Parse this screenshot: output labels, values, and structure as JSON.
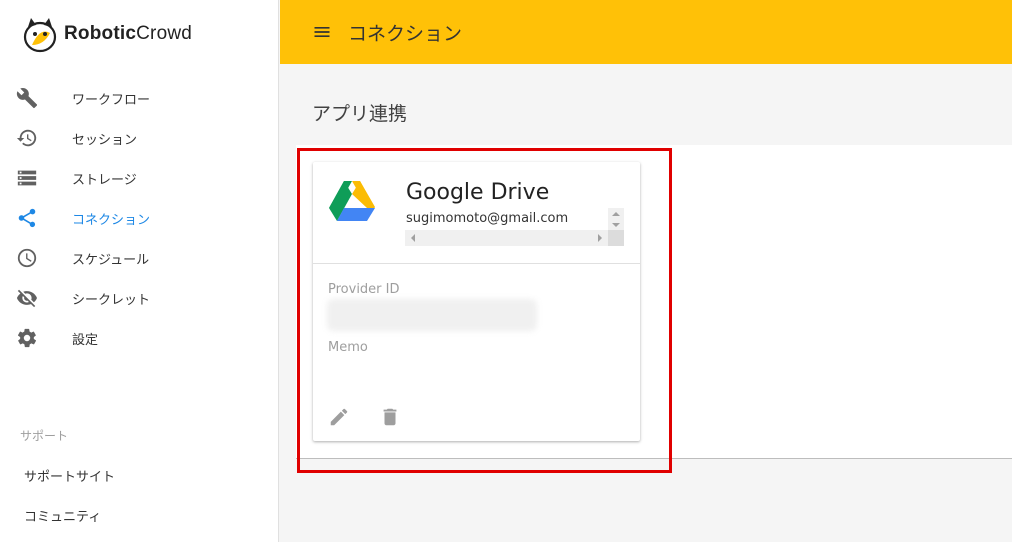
{
  "app": {
    "logo_text_bold": "Robotic",
    "logo_text_light": "Crowd"
  },
  "sidebar": {
    "items": [
      {
        "label": "ワークフロー",
        "icon": "wrench-icon",
        "active": false
      },
      {
        "label": "セッション",
        "icon": "history-icon",
        "active": false
      },
      {
        "label": "ストレージ",
        "icon": "storage-list-icon",
        "active": false
      },
      {
        "label": "コネクション",
        "icon": "share-icon",
        "active": true
      },
      {
        "label": "スケジュール",
        "icon": "clock-icon",
        "active": false
      },
      {
        "label": "シークレット",
        "icon": "eye-off-icon",
        "active": false
      },
      {
        "label": "設定",
        "icon": "gear-icon",
        "active": false
      }
    ],
    "support_title": "サポート",
    "support_links": [
      "サポートサイト",
      "コミュニティ"
    ]
  },
  "header": {
    "title": "コネクション"
  },
  "section": {
    "title": "アプリ連携"
  },
  "card": {
    "title": "Google Drive",
    "email": "sugimomoto@gmail.com",
    "provider_label": "Provider ID",
    "memo_label": "Memo"
  },
  "colors": {
    "header": "#ffc107",
    "active": "#1e88e5",
    "highlight": "#e00000"
  }
}
